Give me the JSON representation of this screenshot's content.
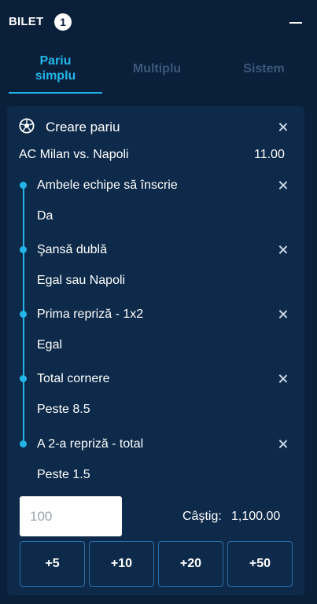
{
  "header": {
    "title": "BILET",
    "badge_count": "1"
  },
  "tabs": [
    {
      "label": "Pariu simplu",
      "line1": "Pariu",
      "line2": "simplu",
      "active": true
    },
    {
      "label": "Multiplu",
      "active": false
    },
    {
      "label": "Sistem",
      "active": false
    }
  ],
  "bet": {
    "builder_label": "Creare pariu",
    "match": "AC Milan vs. Napoli",
    "odds": "11.00",
    "selections": [
      {
        "market": "Ambele echipe să înscrie",
        "pick": "Da"
      },
      {
        "market": "Şansă dublă",
        "pick": "Egal sau Napoli"
      },
      {
        "market": "Prima repriză - 1x2",
        "pick": "Egal"
      },
      {
        "market": "Total cornere",
        "pick": "Peste 8.5"
      },
      {
        "market": "A 2-a repriză - total",
        "pick": "Peste 1.5"
      }
    ]
  },
  "stake": {
    "placeholder": "100",
    "win_label": "Câştig:",
    "win_value": "1,100.00"
  },
  "quick_stakes": [
    "+5",
    "+10",
    "+20",
    "+50"
  ],
  "colors": {
    "background": "#0a1f3a",
    "card": "#0e2a4a",
    "accent": "#23b5e8",
    "inactive_tab": "#3d5778",
    "button_border": "#2c6fa8"
  },
  "icons": [
    "collapse-icon",
    "soccer-ball-icon",
    "close-icon"
  ]
}
